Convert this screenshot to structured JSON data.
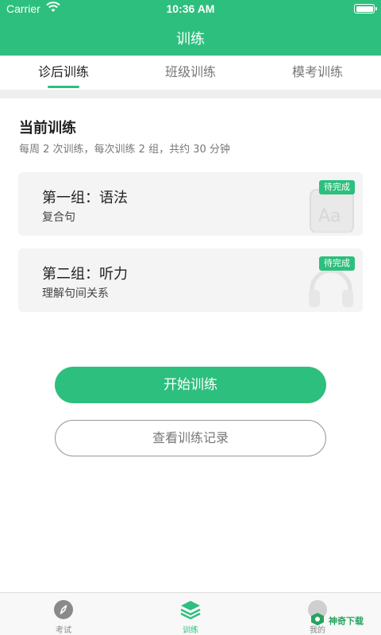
{
  "status_bar": {
    "carrier": "Carrier",
    "time": "10:36 AM"
  },
  "header": {
    "title": "训练"
  },
  "tabs": [
    {
      "label": "诊后训练",
      "active": true
    },
    {
      "label": "班级训练",
      "active": false
    },
    {
      "label": "模考训练",
      "active": false
    }
  ],
  "current": {
    "title": "当前训练",
    "subtitle": "每周 2 次训练，每次训练 2 组，共约 30 分钟"
  },
  "cards": [
    {
      "title": "第一组：语法",
      "subtitle": "复合句",
      "badge": "待完成",
      "icon": "aa-keyboard-icon"
    },
    {
      "title": "第二组：听力",
      "subtitle": "理解句间关系",
      "badge": "待完成",
      "icon": "headphones-icon"
    }
  ],
  "buttons": {
    "start": "开始训练",
    "history": "查看训练记录"
  },
  "tabbar": [
    {
      "label": "考试",
      "icon": "compass-icon",
      "active": false
    },
    {
      "label": "训练",
      "icon": "layers-icon",
      "active": true
    },
    {
      "label": "",
      "icon": "message-icon",
      "active": false
    },
    {
      "label": "我的",
      "icon": "profile-icon",
      "active": false
    }
  ],
  "watermark": {
    "text": "神奇下载"
  },
  "colors": {
    "accent": "#2dbf7d",
    "background": "#ffffff",
    "band": "#efefef",
    "card": "#f3f4f3"
  }
}
